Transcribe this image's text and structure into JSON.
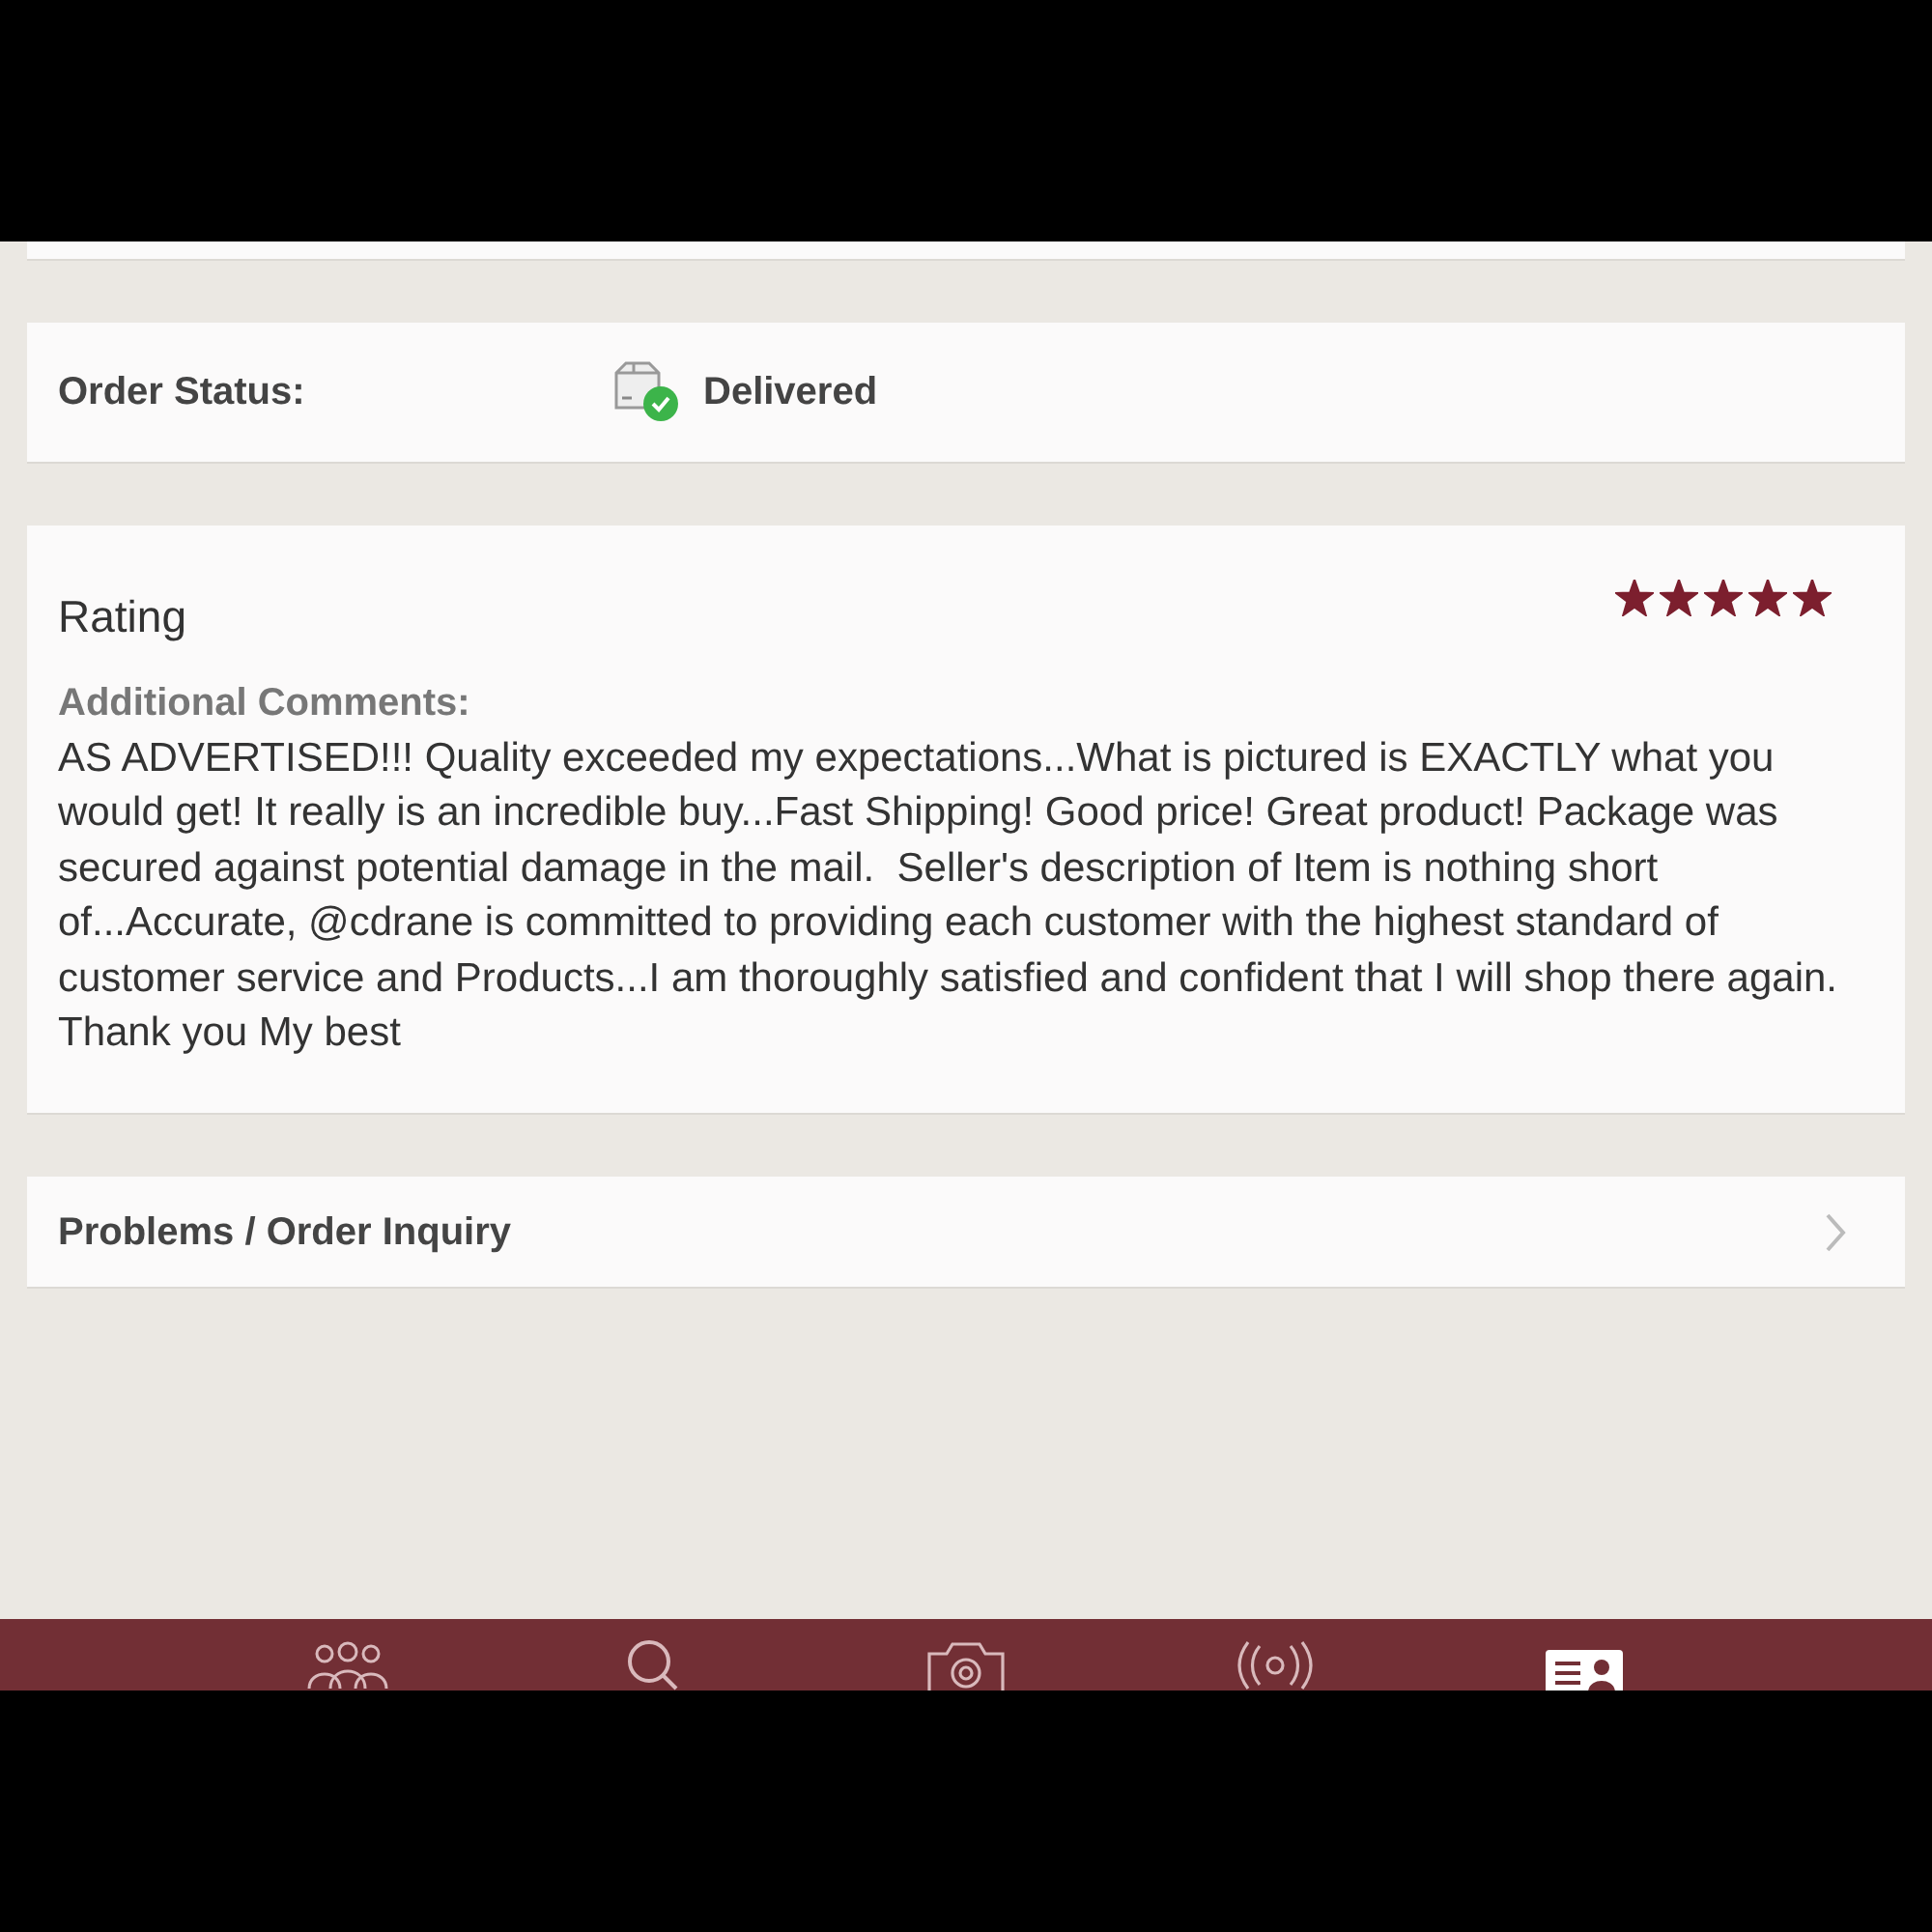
{
  "order_status": {
    "label": "Order Status:",
    "value": "Delivered"
  },
  "rating": {
    "title": "Rating",
    "stars": 5,
    "comments_label": "Additional Comments:",
    "comments": "AS ADVERTISED!!! Quality exceeded my expectations...What is pictured is EXACTLY what you would get! It really is an incredible buy...Fast Shipping! Good price! Great product! Package was secured against potential damage in the mail.  Seller's description of Item is nothing short of...Accurate, @cdrane is committed to providing each customer with the highest standard of customer service and Products...I am thoroughly satisfied and confident that I will shop there again. Thank you My best"
  },
  "inquiry": {
    "label": "Problems / Order Inquiry"
  },
  "tab_bar": [
    {
      "kind": "people",
      "selected": false
    },
    {
      "kind": "search",
      "selected": false
    },
    {
      "kind": "camera",
      "selected": false
    },
    {
      "kind": "broadcast",
      "selected": false
    },
    {
      "kind": "profile",
      "selected": true
    }
  ]
}
